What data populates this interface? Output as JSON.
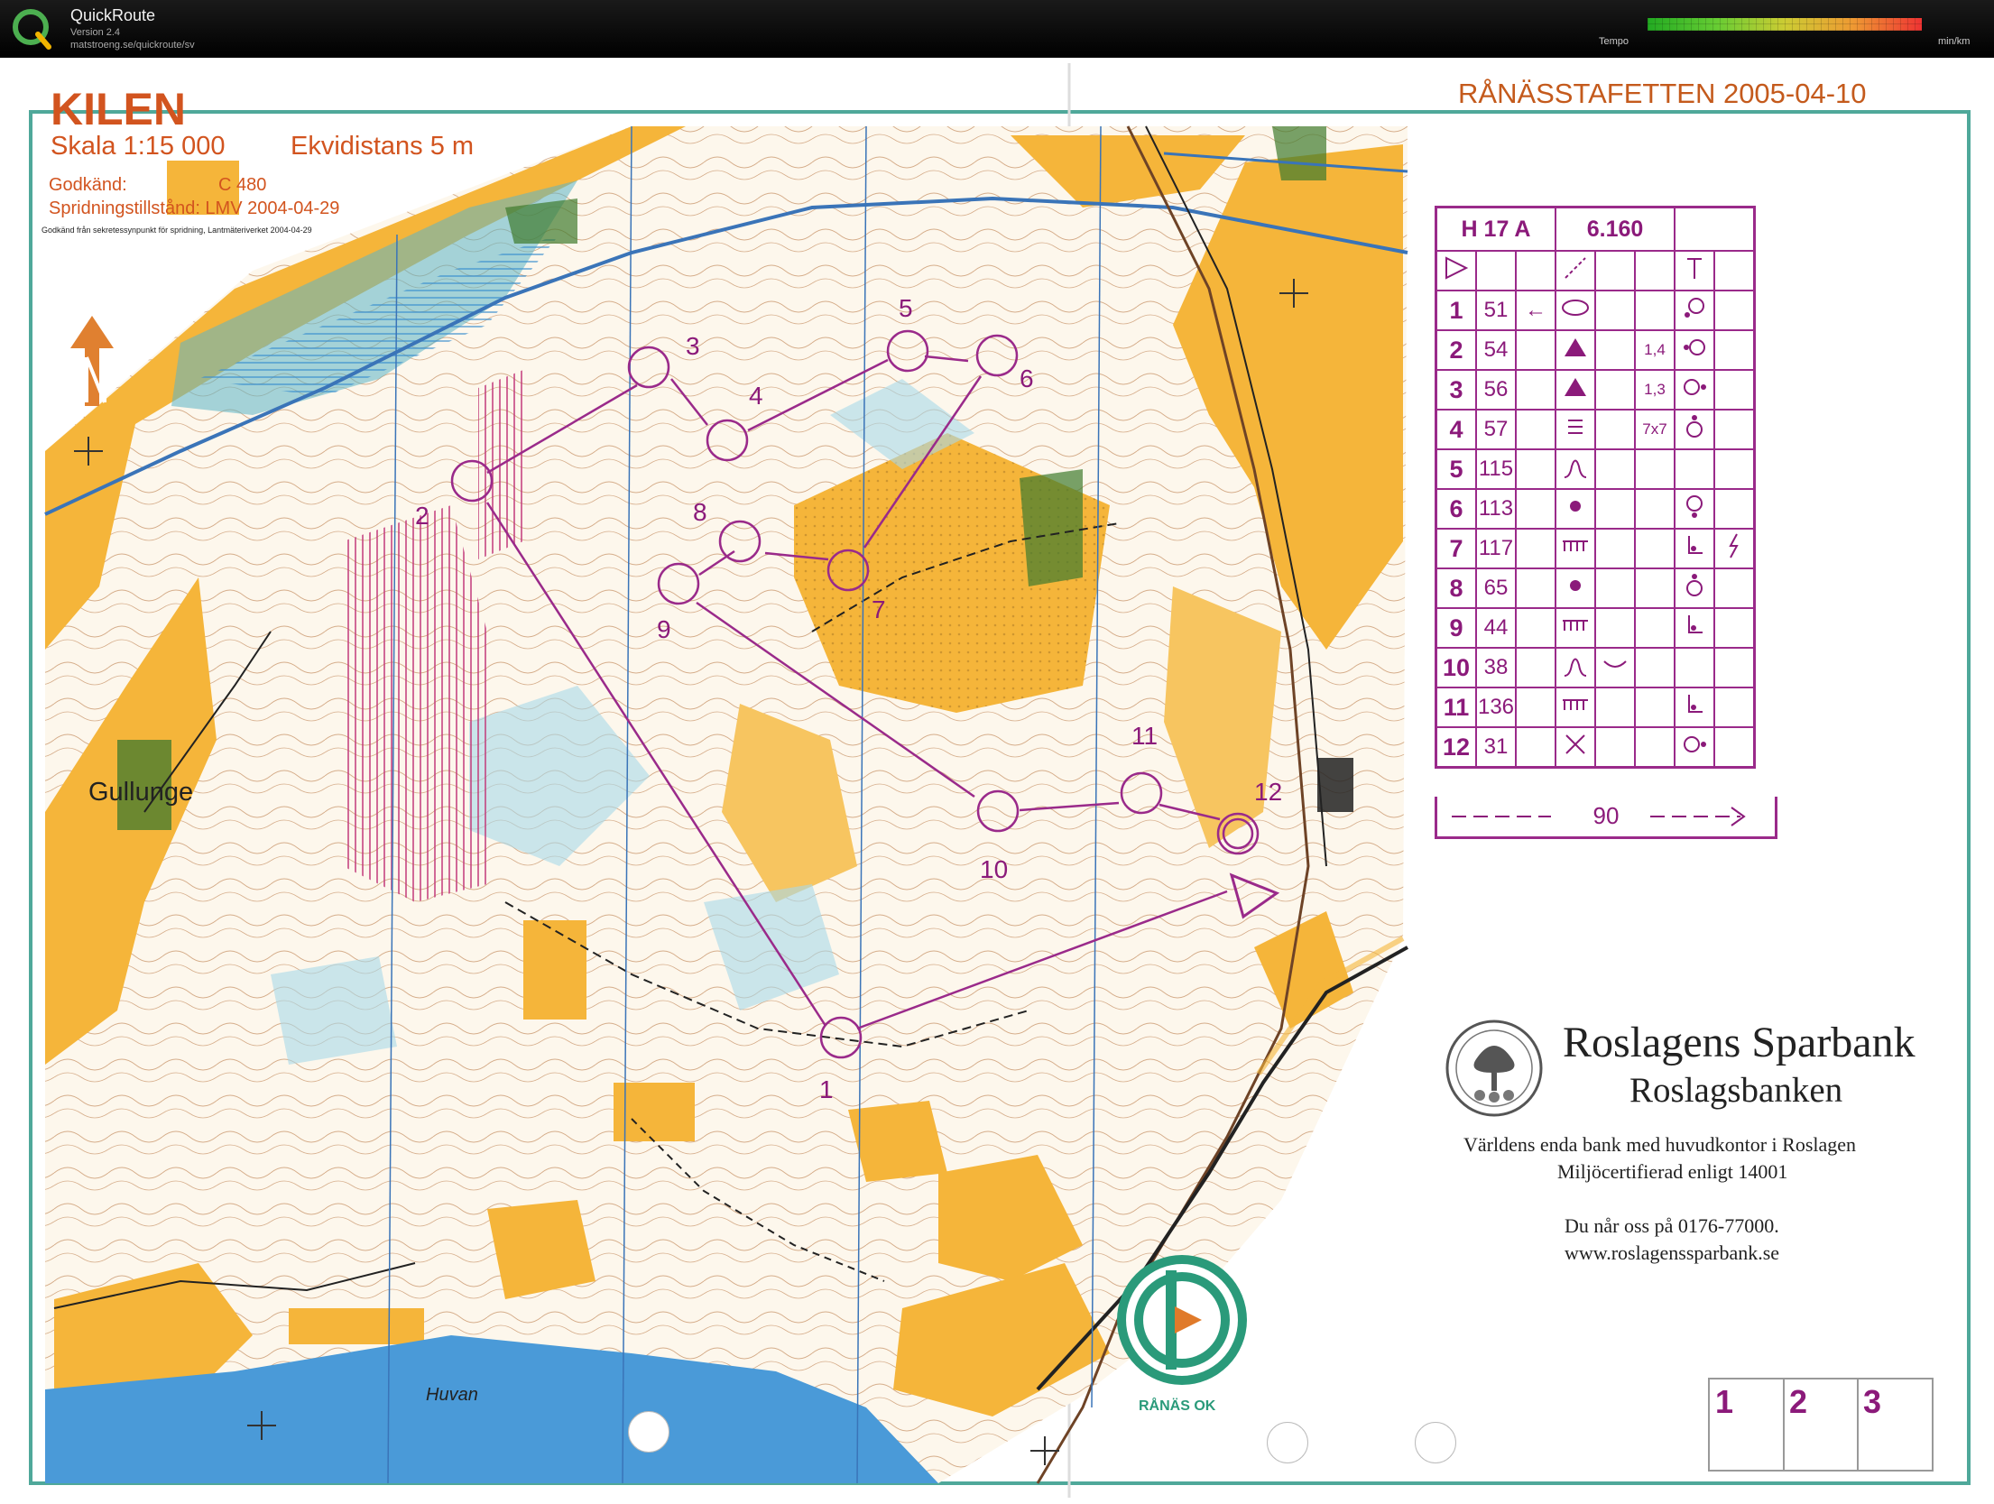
{
  "app": {
    "title": "QuickRoute",
    "version": "Version 2.4",
    "url": "matstroeng.se/quickroute/sv",
    "tempo_label": "Tempo",
    "tempo_unit": "min/km"
  },
  "map": {
    "title": "KILEN",
    "scale": "Skala 1:15 000",
    "equidistance": "Ekvidistans 5 m",
    "approved_label": "Godkänd:",
    "approved_value": "C 480",
    "permit": "Spridningstillstånd: LMV 2004-04-29",
    "secrecy_note": "Godkänd från sekretessynpunkt för spridning, Lantmäteriverket 2004-04-29",
    "places": {
      "gullunge": "Gullunge",
      "huvan": "Huvan"
    },
    "club": "RÅNÄS OK"
  },
  "event": {
    "title": "RÅNÄSSTAFETTEN 2005-04-10"
  },
  "course": {
    "class": "H 17 A",
    "length": "6.160",
    "control_labels": [
      "1",
      "2",
      "3",
      "4",
      "5",
      "6",
      "7",
      "8",
      "9",
      "10",
      "11",
      "12"
    ],
    "descriptions": [
      {
        "num": "1",
        "code": "51",
        "dir": "←",
        "feature": "ellipse",
        "dim": "",
        "pos": "circle-bl"
      },
      {
        "num": "2",
        "code": "54",
        "dir": "",
        "feature": "triangle",
        "dim": "1,4",
        "pos": "circle-l"
      },
      {
        "num": "3",
        "code": "56",
        "dir": "",
        "feature": "triangle",
        "dim": "1,3",
        "pos": "circle-r"
      },
      {
        "num": "4",
        "code": "57",
        "dir": "",
        "feature": "bars",
        "dim": "7x7",
        "pos": "circle-t"
      },
      {
        "num": "5",
        "code": "115",
        "dir": "",
        "feature": "bell",
        "dim": "",
        "pos": ""
      },
      {
        "num": "6",
        "code": "113",
        "dir": "",
        "feature": "dot",
        "dim": "",
        "pos": "circle-b"
      },
      {
        "num": "7",
        "code": "117",
        "dir": "",
        "feature": "comb",
        "dim": "",
        "pos": "corner",
        "extra": "bolt"
      },
      {
        "num": "8",
        "code": "65",
        "dir": "",
        "feature": "dot",
        "dim": "",
        "pos": "circle-t"
      },
      {
        "num": "9",
        "code": "44",
        "dir": "",
        "feature": "comb",
        "dim": "",
        "pos": "corner"
      },
      {
        "num": "10",
        "code": "38",
        "dir": "",
        "feature": "bell",
        "dim": "",
        "pos": "",
        "extra": "curve"
      },
      {
        "num": "11",
        "code": "136",
        "dir": "",
        "feature": "comb",
        "dim": "",
        "pos": "corner"
      },
      {
        "num": "12",
        "code": "31",
        "dir": "",
        "feature": "cross",
        "dim": "",
        "pos": "circle-r"
      }
    ],
    "finish_distance": "90"
  },
  "bank": {
    "name": "Roslagens Sparbank",
    "sub": "Roslagsbanken",
    "line1": "Världens enda bank med huvudkontor i Roslagen",
    "line2": "Miljöcertifierad enligt 14001",
    "phone": "Du når oss på 0176-77000.",
    "web": "www.roslagenssparbank.se"
  },
  "legs": [
    "1",
    "2",
    "3"
  ],
  "colors": {
    "course": "#9a2a8a",
    "open_land": "#f5b53a",
    "water": "#4a9ad8",
    "marsh": "#5bb4c6",
    "forest": "#ffffff",
    "contour": "#a0522d"
  }
}
